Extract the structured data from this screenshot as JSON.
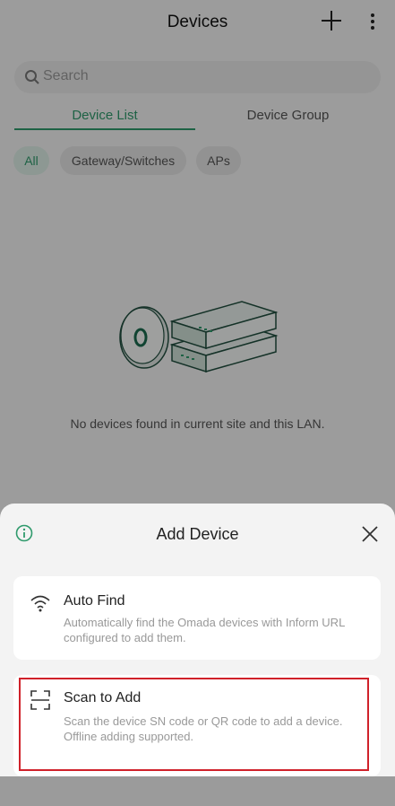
{
  "header": {
    "title": "Devices",
    "add_icon": "plus-icon",
    "more_icon": "more-vertical-icon"
  },
  "search": {
    "placeholder": "Search",
    "icon": "search-icon"
  },
  "tabs": [
    {
      "label": "Device List",
      "active": true
    },
    {
      "label": "Device Group",
      "active": false
    }
  ],
  "filters": [
    {
      "label": "All",
      "selected": true
    },
    {
      "label": "Gateway/Switches",
      "selected": false
    },
    {
      "label": "APs",
      "selected": false
    }
  ],
  "empty_state": {
    "illustration": "devices-illustration",
    "message": "No devices found in current site and this LAN."
  },
  "sheet": {
    "title": "Add Device",
    "info_icon": "info-icon",
    "close_icon": "close-icon",
    "options": [
      {
        "icon": "wifi-icon",
        "title": "Auto Find",
        "description": "Automatically find the Omada devices with Inform URL configured to add them."
      },
      {
        "icon": "scan-icon",
        "title": "Scan to Add",
        "description": "Scan the device SN code or QR code to add a device. Offline adding supported."
      }
    ]
  },
  "colors": {
    "accent": "#2f9a6c",
    "highlight": "#d0212a"
  }
}
